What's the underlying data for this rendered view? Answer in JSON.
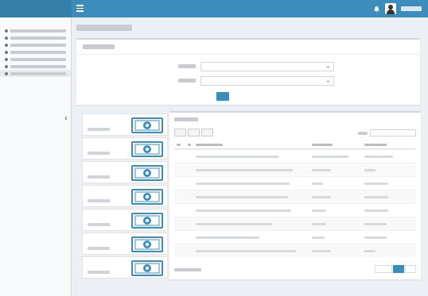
{
  "app": {
    "brand": "",
    "username": ""
  },
  "sidebar": {
    "header": "",
    "items": [
      {
        "label": "",
        "active": false
      },
      {
        "label": "",
        "active": false
      },
      {
        "label": "",
        "active": false
      },
      {
        "label": "",
        "active": false
      },
      {
        "label": "",
        "active": false
      },
      {
        "label": "",
        "active": false
      },
      {
        "label": "",
        "active": true
      }
    ]
  },
  "page": {
    "title": ""
  },
  "filter": {
    "title": "",
    "fields": [
      {
        "label": "",
        "value": ""
      },
      {
        "label": "",
        "value": ""
      }
    ],
    "submit_label": ""
  },
  "stats": [
    {
      "value": "",
      "label": ""
    },
    {
      "value": "",
      "label": ""
    },
    {
      "value": "",
      "label": ""
    },
    {
      "value": "",
      "label": ""
    },
    {
      "value": "",
      "label": ""
    },
    {
      "value": "",
      "label": ""
    },
    {
      "value": "",
      "label": ""
    }
  ],
  "table": {
    "title": "",
    "buttons": [
      "",
      "",
      ""
    ],
    "search_label": "",
    "search_placeholder": "",
    "columns": [
      "",
      "",
      "",
      "",
      ""
    ],
    "rows": [
      [
        "",
        "",
        "",
        "",
        ""
      ],
      [
        "",
        "",
        "",
        "",
        ""
      ],
      [
        "",
        "",
        "",
        "",
        ""
      ],
      [
        "",
        "",
        "",
        "",
        ""
      ],
      [
        "",
        "",
        "",
        "",
        ""
      ],
      [
        "",
        "",
        "",
        "",
        ""
      ],
      [
        "",
        "",
        "",
        "",
        ""
      ],
      [
        "",
        "",
        "",
        "",
        ""
      ]
    ],
    "info": "",
    "pagination": {
      "prev": "",
      "current": "",
      "next": ""
    }
  },
  "colors": {
    "primary": "#3c8dbc",
    "brand_bg": "#367fa9",
    "stat_icon": "#3c8dbc",
    "sidebar_bg": "#f9fafc",
    "body_bg": "#ecf0f5"
  },
  "icons": {
    "menu": "hamburger-icon",
    "notification": "bell-icon",
    "user": "user-icon",
    "stat": "money-bill-icon",
    "sidebar_item": "circle-icon",
    "collapse": "chevron-left-icon",
    "select_caret": "chevron-down-icon"
  }
}
